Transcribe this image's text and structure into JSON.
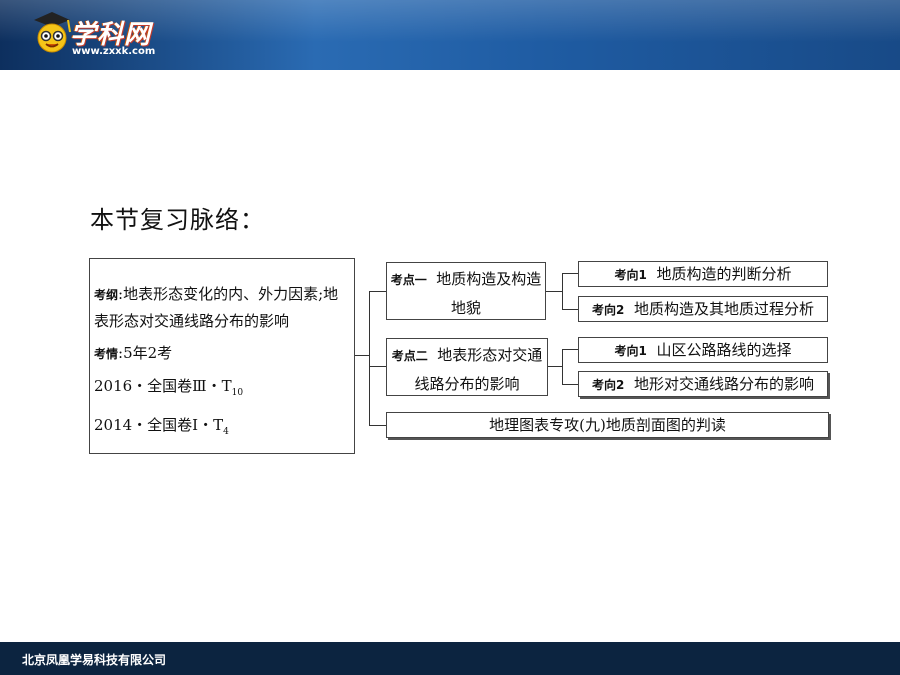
{
  "header": {
    "logo_text": "学科网",
    "logo_url": "www.zxxk.com"
  },
  "title": "本节复习脉络：",
  "outline": {
    "kaogang_tag": "考纲",
    "kaogang_text": ":地表形态变化的内、外力因素;地表形态对交通线路分布的影响",
    "kaoqing_tag": "考情",
    "kaoqing_text": ":5年2考",
    "exam1_main": "2016・全国卷Ⅲ・T",
    "exam1_sub": "10",
    "exam2_main": "2014・全国卷Ⅰ・T",
    "exam2_sub": "4"
  },
  "points": [
    {
      "tag": "考点一",
      "text": "地质构造及构造地貌",
      "directions": [
        {
          "tag": "考向1",
          "text": "地质构造的判断分析"
        },
        {
          "tag": "考向2",
          "text": "地质构造及其地质过程分析"
        }
      ]
    },
    {
      "tag": "考点二",
      "text": "地表形态对交通线路分布的影响",
      "directions": [
        {
          "tag": "考向1",
          "text": "山区公路路线的选择"
        },
        {
          "tag": "考向2",
          "text": "地形对交通线路分布的影响"
        }
      ]
    }
  ],
  "special": "地理图表专攻(九)地质剖面图的判读",
  "footer": "北京凤凰学易科技有限公司"
}
